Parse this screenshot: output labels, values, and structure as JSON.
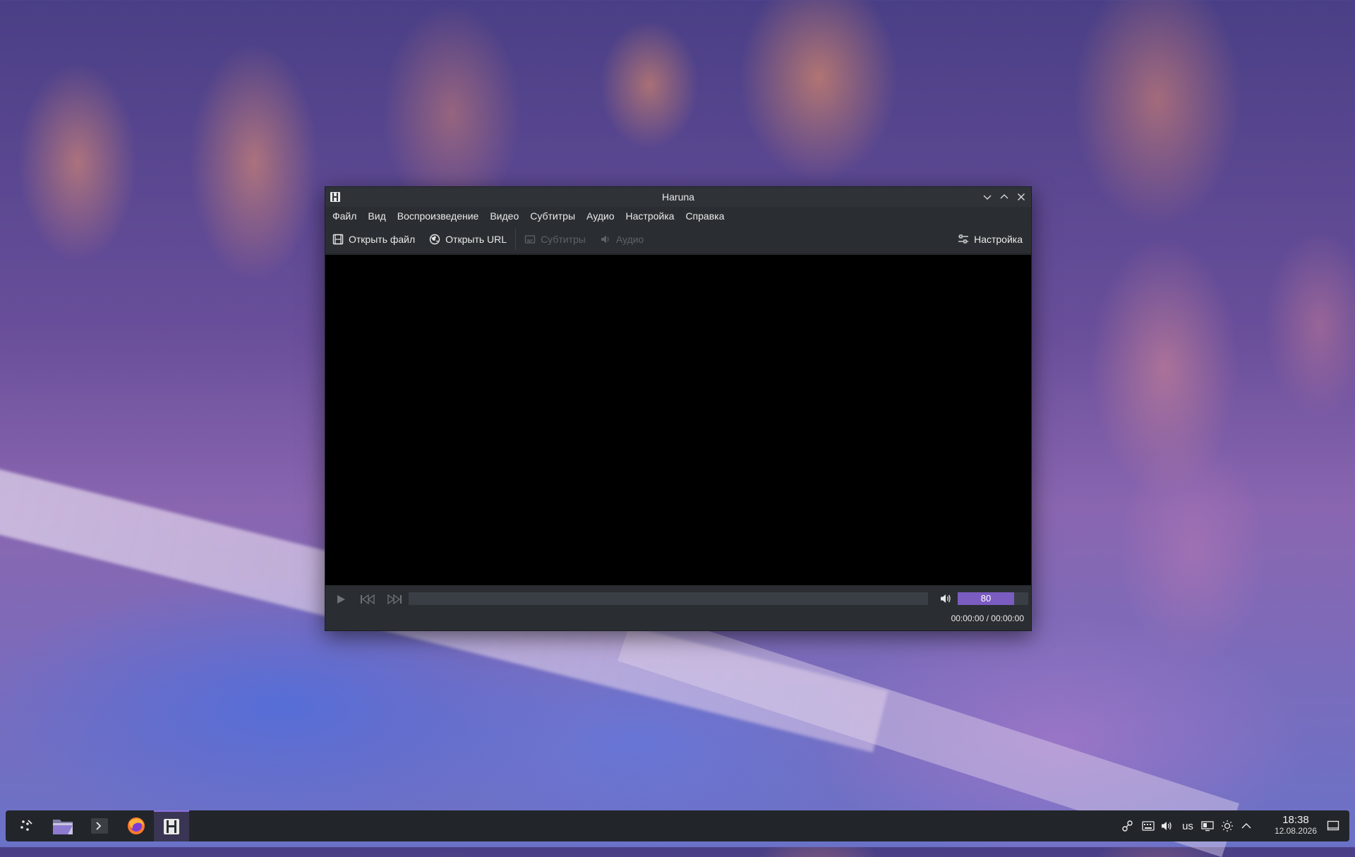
{
  "window": {
    "title": "Haruna"
  },
  "menu": [
    "Файл",
    "Вид",
    "Воспроизведение",
    "Видео",
    "Субтитры",
    "Аудио",
    "Настройка",
    "Справка"
  ],
  "toolbar": {
    "open_file": "Открыть файл",
    "open_url": "Открыть URL",
    "subtitles": "Субтитры",
    "audio": "Аудио",
    "settings": "Настройка"
  },
  "controls": {
    "volume": "80",
    "volume_level": 0.8,
    "time": "00:00:00 / 00:00:00"
  },
  "taskbar": {
    "keyboard_layout": "us",
    "clock_time": "18:38",
    "clock_date": "12.08.2026"
  },
  "colors": {
    "accent": "#7b5cc1",
    "window_bg": "#2a2e32",
    "video_bg": "#000000",
    "taskbar_bg": "#22262a"
  }
}
